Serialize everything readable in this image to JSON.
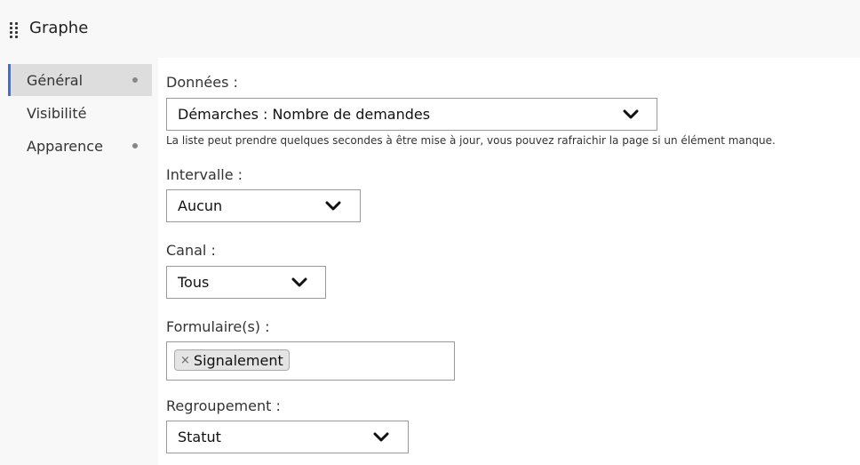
{
  "header": {
    "title": "Graphe",
    "drag_icon": "drag-handle-icon"
  },
  "sidebar": {
    "items": [
      {
        "label": "Général",
        "active": true,
        "has_dot": true
      },
      {
        "label": "Visibilité",
        "active": false,
        "has_dot": false
      },
      {
        "label": "Apparence",
        "active": false,
        "has_dot": true
      }
    ],
    "accent_color": "#3b6fd4"
  },
  "form": {
    "donnees": {
      "label": "Données :",
      "value": "Démarches : Nombre de demandes",
      "hint": "La liste peut prendre quelques secondes à être mise à jour, vous pouvez rafraichir la page si un élément manque."
    },
    "intervalle": {
      "label": "Intervalle :",
      "value": "Aucun"
    },
    "canal": {
      "label": "Canal :",
      "value": "Tous"
    },
    "formulaires": {
      "label": "Formulaire(s) :",
      "tags": [
        {
          "remove": "×",
          "label": "Signalement"
        }
      ]
    },
    "regroupement": {
      "label": "Regroupement :",
      "value": "Statut"
    }
  }
}
